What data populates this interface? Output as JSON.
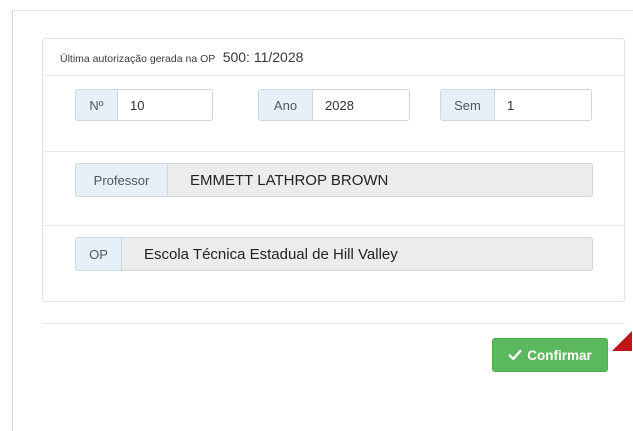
{
  "last_authorization": {
    "prefix": "Última autorização gerada na OP",
    "value": "500: 11/2028"
  },
  "fields": {
    "numero": {
      "label": "Nº",
      "value": "10"
    },
    "ano": {
      "label": "Ano",
      "value": "2028"
    },
    "sem": {
      "label": "Sem",
      "value": "1"
    },
    "professor": {
      "label": "Professor",
      "value": "EMMETT LATHROP BROWN"
    },
    "op": {
      "label": "OP",
      "value": "Escola Técnica Estadual de Hill Valley"
    }
  },
  "actions": {
    "confirm_label": "Confirmar",
    "confirm_icon": "check-icon",
    "button_color": "#5cb85c"
  },
  "annotation": {
    "arrow_icon": "red-arrow-pointer-icon",
    "arrow_color": "#c0151a"
  }
}
